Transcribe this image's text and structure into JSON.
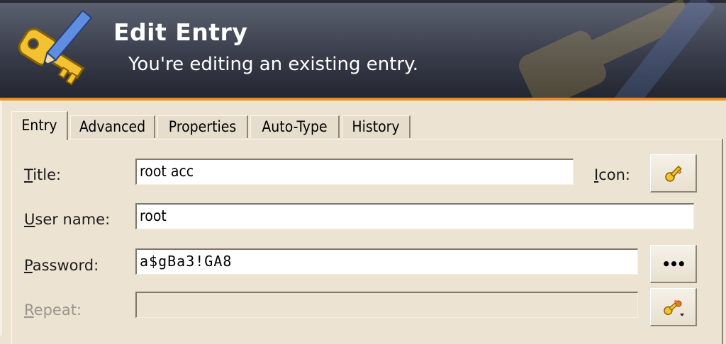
{
  "banner": {
    "title": "Edit Entry",
    "subtitle": "You're editing an existing entry.",
    "logo_icon": "key-pencil-icon"
  },
  "tabs": [
    {
      "label": "Entry",
      "active": true
    },
    {
      "label": "Advanced",
      "active": false
    },
    {
      "label": "Properties",
      "active": false
    },
    {
      "label": "Auto-Type",
      "active": false
    },
    {
      "label": "History",
      "active": false
    }
  ],
  "form": {
    "title": {
      "label_mnemonic": "T",
      "label_rest": "itle:",
      "value": "root acc"
    },
    "icon": {
      "label_mnemonic": "I",
      "label_rest": "con:",
      "button_icon": "key-icon"
    },
    "username": {
      "label_mnemonic": "U",
      "label_rest": "ser name:",
      "value": "root"
    },
    "password": {
      "label_mnemonic": "P",
      "label_rest": "assword:",
      "value": "a$gBa3!GA8",
      "toggle_button": "•••"
    },
    "repeat": {
      "label_mnemonic": "R",
      "label_rest": "epeat:",
      "value": "",
      "generator_icon": "password-generator-icon"
    }
  },
  "colors": {
    "banner_dark": "#23262f",
    "banner_accent_line": "#e88c2c",
    "dialog_bg": "#ede3d3"
  }
}
